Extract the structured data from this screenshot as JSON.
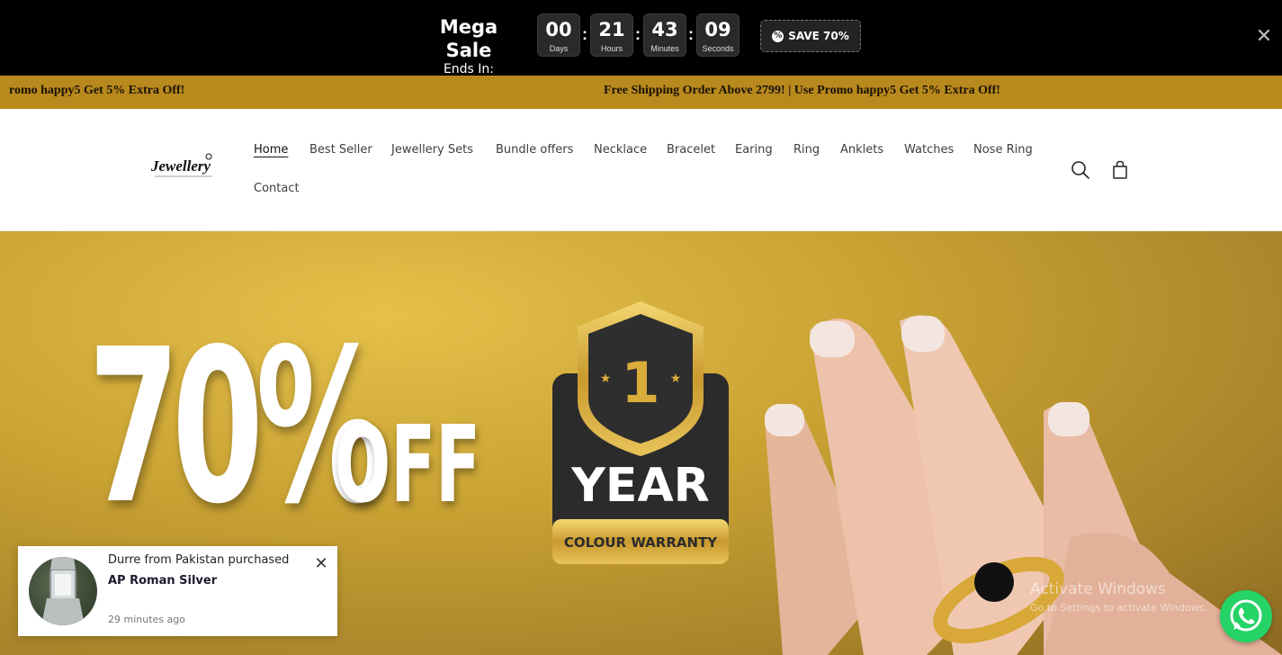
{
  "countdown": {
    "title": "Mega Sale",
    "subtitle": "Ends In:",
    "units": [
      {
        "value": "00",
        "label": "Days"
      },
      {
        "value": "21",
        "label": "Hours"
      },
      {
        "value": "43",
        "label": "Minutes"
      },
      {
        "value": "09",
        "label": "Seconds"
      }
    ],
    "separator": ":",
    "save_label": "SAVE 70%",
    "close_icon": "close-icon"
  },
  "promo": {
    "left_text": "romo happy5 Get 5% Extra Off!",
    "right_text": "Free Shipping Order Above 2799!  |  Use Promo happy5 Get 5% Extra Off!"
  },
  "header": {
    "logo_text": "Jewellery",
    "nav": [
      "Home",
      "Best Seller",
      "Jewellery Sets",
      "Bundle offers",
      "Necklace",
      "Bracelet",
      "Earing",
      "Ring",
      "Anklets",
      "Watches",
      "Nose Ring",
      "Contact"
    ],
    "active": "Home",
    "icons": [
      "search-icon",
      "cart-icon"
    ]
  },
  "hero": {
    "discount": "70%",
    "off": "OFF",
    "badge_number": "1",
    "badge_year": "YEAR",
    "badge_ribbon": "COLOUR WARRANTY"
  },
  "popup": {
    "line1": "Durre from Pakistan purchased",
    "product": "AP Roman Silver",
    "time": "29 minutes ago"
  },
  "watermark": {
    "line1": "Activate Windows",
    "line2": "Go to Settings to activate Windows."
  },
  "colors": {
    "topbar": "#000000",
    "promo": "#b8891c",
    "hero_gold": "#c9a233",
    "whatsapp": "#25d366"
  }
}
